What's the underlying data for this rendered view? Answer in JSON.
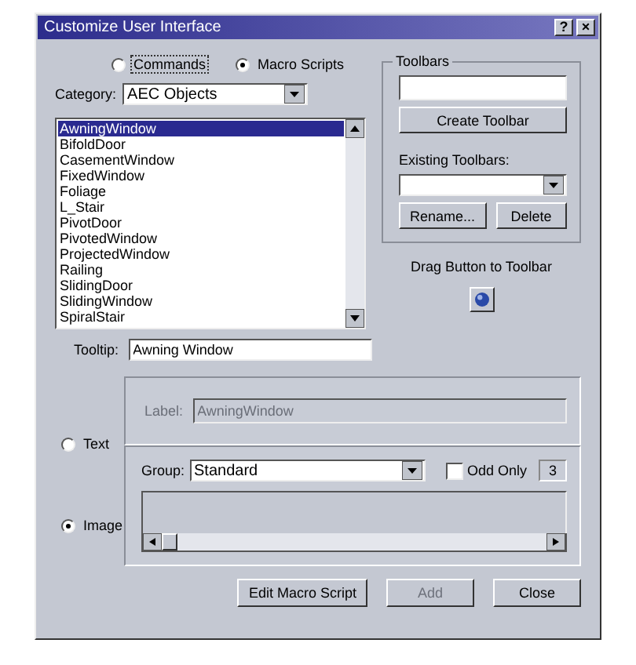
{
  "window": {
    "title": "Customize User Interface",
    "help_button": "?",
    "close_button": "×"
  },
  "mode_options": [
    {
      "label": "Commands",
      "selected": false
    },
    {
      "label": "Macro Scripts",
      "selected": true
    }
  ],
  "category": {
    "label": "Category:",
    "value": "AEC Objects"
  },
  "scripts": [
    {
      "label": "AwningWindow",
      "selected": true
    },
    {
      "label": "BifoldDoor",
      "selected": false
    },
    {
      "label": "CasementWindow",
      "selected": false
    },
    {
      "label": "FixedWindow",
      "selected": false
    },
    {
      "label": "Foliage",
      "selected": false
    },
    {
      "label": "L_Stair",
      "selected": false
    },
    {
      "label": "PivotDoor",
      "selected": false
    },
    {
      "label": "PivotedWindow",
      "selected": false
    },
    {
      "label": "ProjectedWindow",
      "selected": false
    },
    {
      "label": "Railing",
      "selected": false
    },
    {
      "label": "SlidingDoor",
      "selected": false
    },
    {
      "label": "SlidingWindow",
      "selected": false
    },
    {
      "label": "SpiralStair",
      "selected": false
    }
  ],
  "toolbars": {
    "title": "Toolbars",
    "create_button": "Create Toolbar",
    "existing_label": "Existing Toolbars:",
    "rename_button": "Rename...",
    "delete_button": "Delete"
  },
  "drag_hint": "Drag Button to Toolbar",
  "tooltip": {
    "label": "Tooltip:",
    "value": "Awning Window"
  },
  "button_types": [
    {
      "label": "Text",
      "selected": false
    },
    {
      "label": "Image",
      "selected": true
    }
  ],
  "text_label": {
    "label": "Label:",
    "value": "AwningWindow",
    "disabled": true
  },
  "image_group": {
    "label": "Group:",
    "value": "Standard",
    "odd_only_label": "Odd Only",
    "odd_only_checked": false,
    "count": "3"
  },
  "buttons": [
    {
      "label": "Edit Macro Script",
      "disabled": false
    },
    {
      "label": "Add",
      "disabled": true
    },
    {
      "label": "Close",
      "disabled": false
    }
  ]
}
